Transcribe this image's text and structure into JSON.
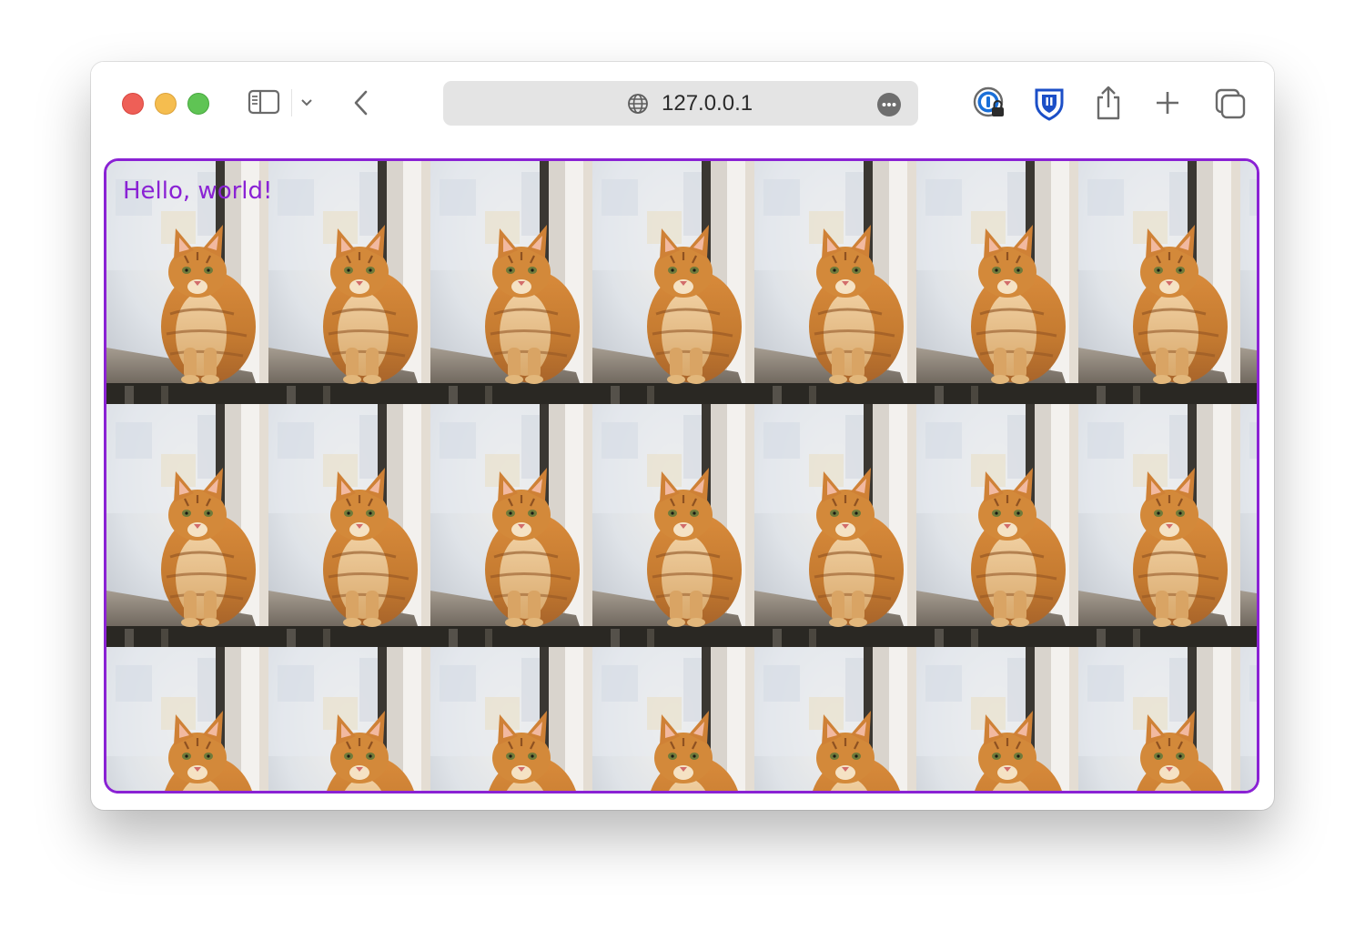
{
  "browser": {
    "url": "127.0.0.1",
    "icons": {
      "sidebar": "sidebar-icon",
      "chevron": "chevron-down-icon",
      "back": "chevron-left-icon",
      "globe": "globe-icon",
      "more": "more-icon",
      "password": "password-manager-icon",
      "bitwarden": "shield-icon",
      "share": "share-icon",
      "new_tab": "plus-icon",
      "tabs": "tab-overview-icon"
    }
  },
  "page": {
    "heading": "Hello, world!",
    "accent_color": "#8a22d4",
    "tile_image": "cat-photo",
    "tile_columns": 7,
    "tile_rows": 3
  }
}
